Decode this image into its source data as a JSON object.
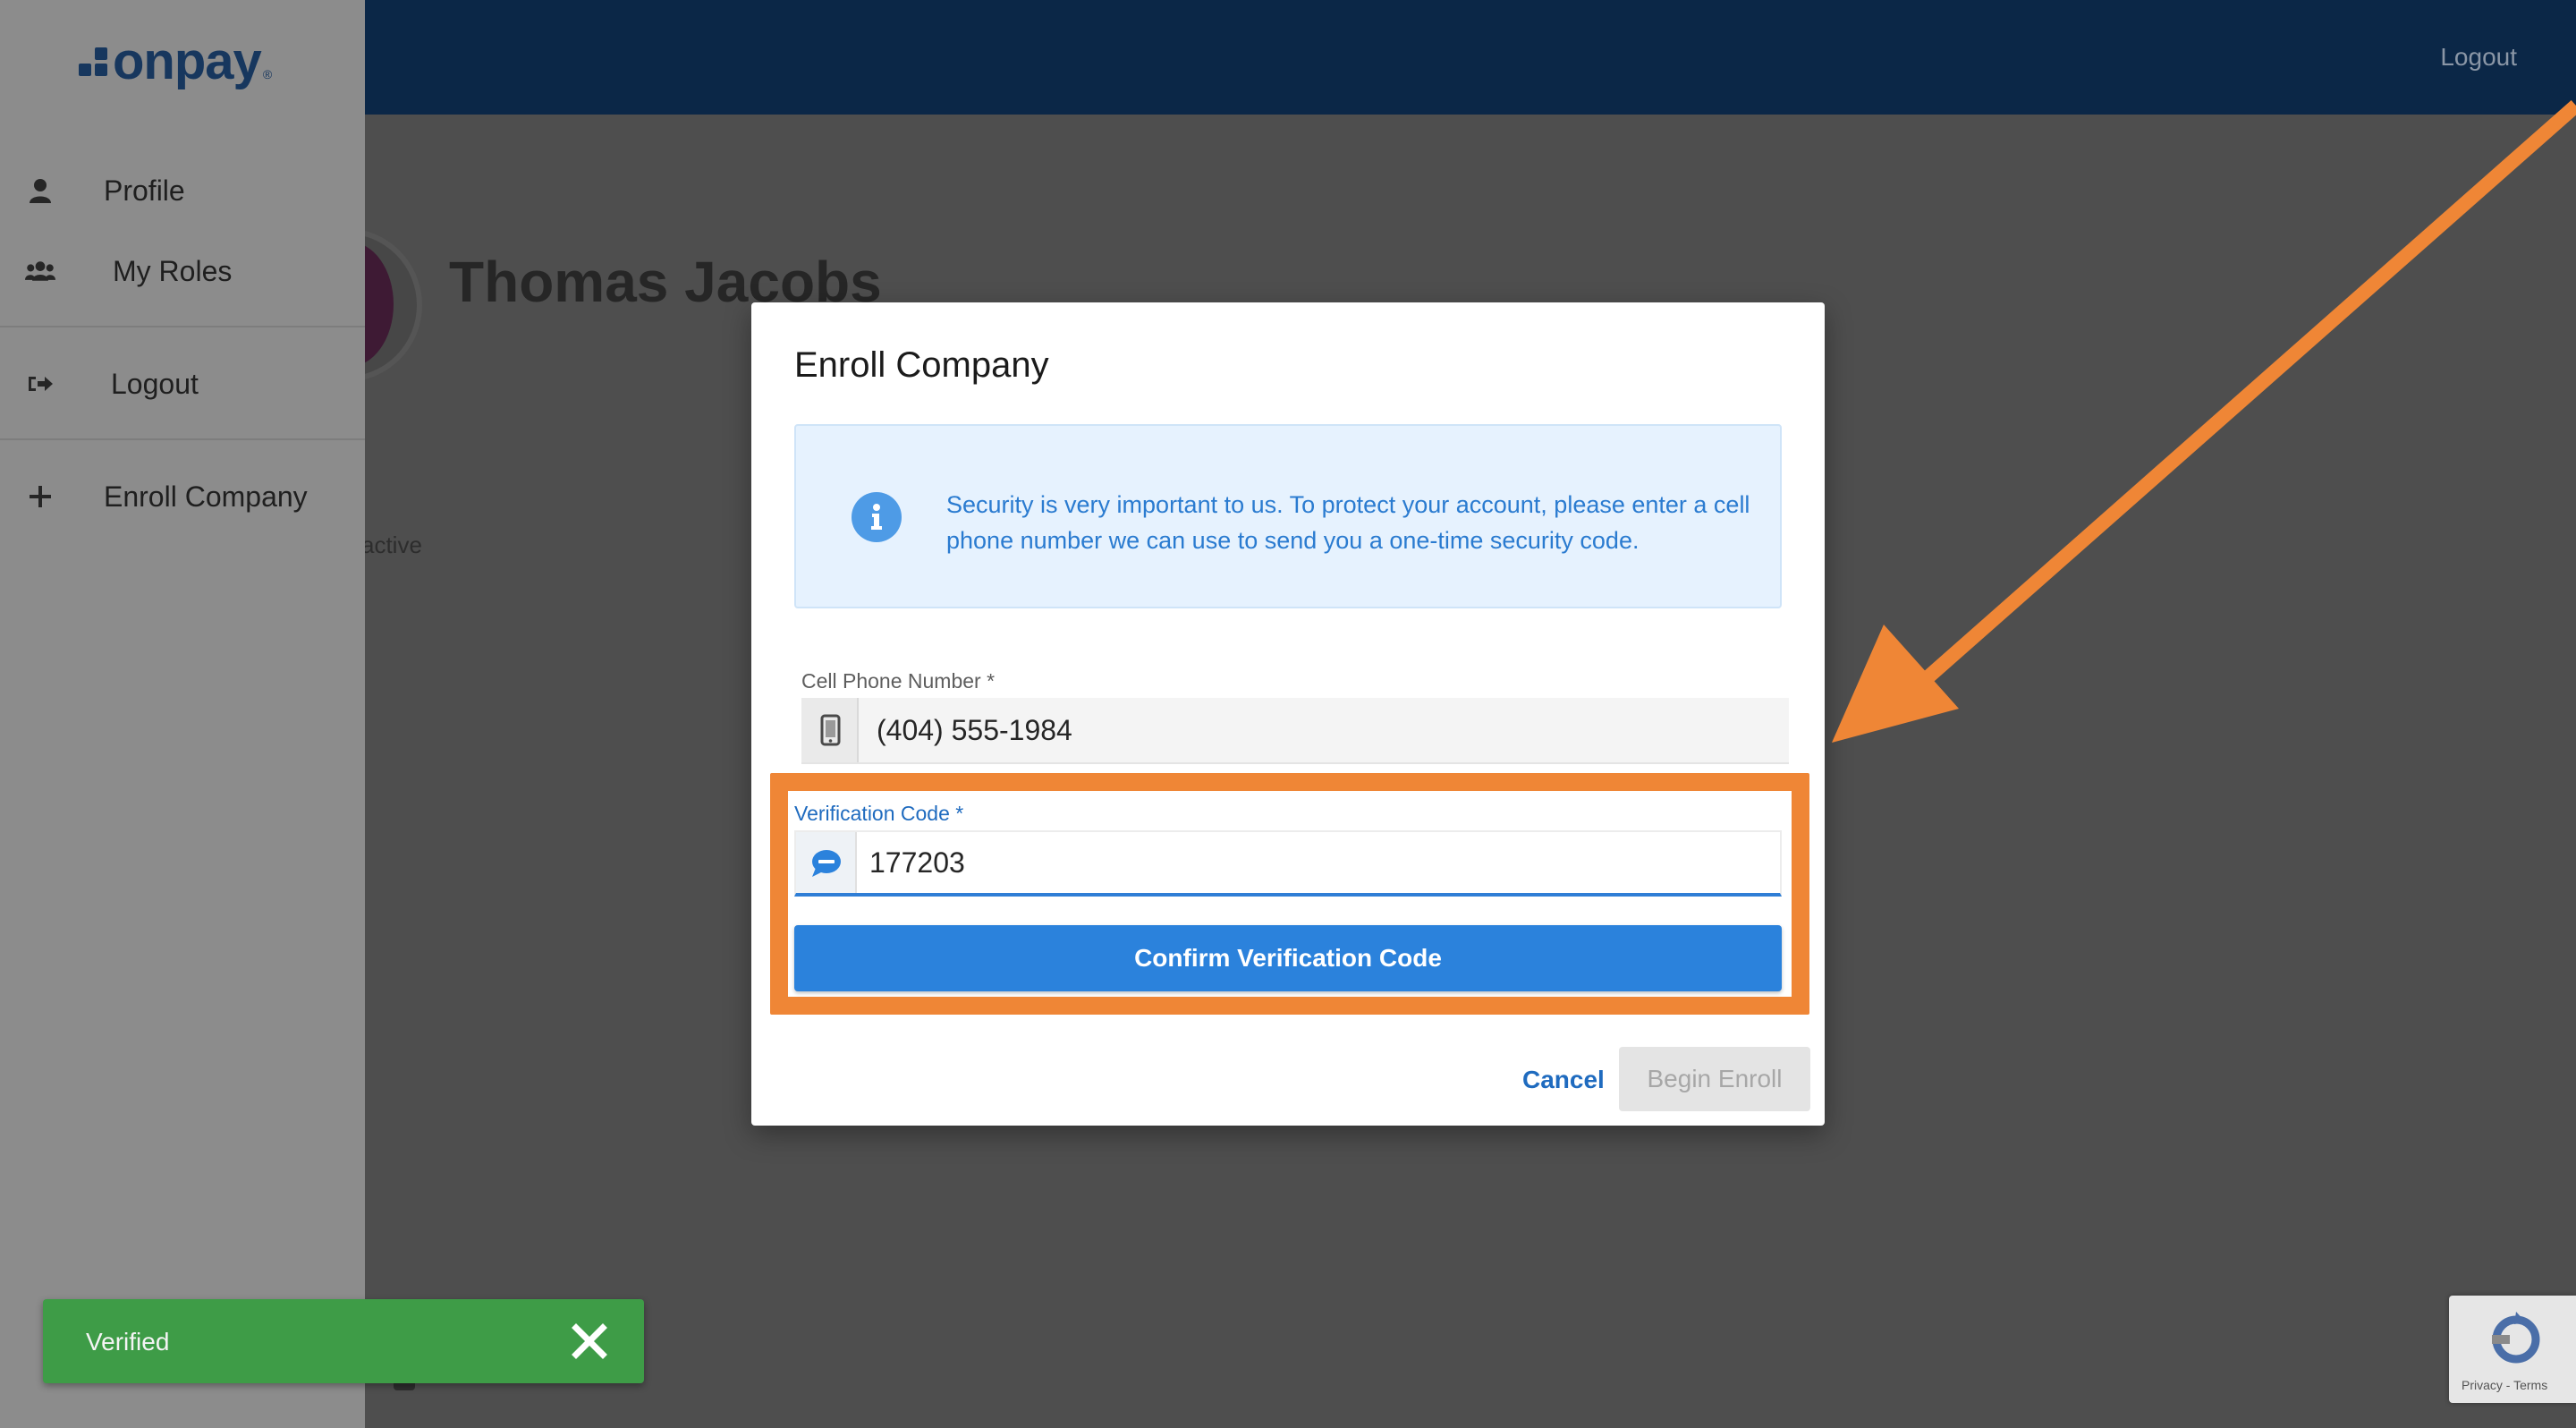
{
  "app": {
    "brand": "onpay",
    "brand_mark": "®"
  },
  "topbar": {
    "logout_label": "Logout"
  },
  "sidebar": {
    "items": [
      {
        "label": "Profile",
        "icon": "user-icon"
      },
      {
        "label": "My Roles",
        "icon": "users-icon"
      },
      {
        "label": "Logout",
        "icon": "sign-out-icon"
      },
      {
        "label": "Enroll Company",
        "icon": "plus-icon"
      }
    ]
  },
  "profile": {
    "name": "Thomas Jacobs",
    "status_fragment": "active"
  },
  "modal": {
    "title": "Enroll Company",
    "info_text": "Security is very important to us. To protect your account, please enter a cell phone number we can use to send you a one-time security code.",
    "phone": {
      "label": "Cell Phone Number *",
      "value": "(404) 555-1984",
      "icon": "mobile-phone-icon"
    },
    "code": {
      "label": "Verification Code *",
      "value": "177203",
      "icon": "sms-icon"
    },
    "confirm_label": "Confirm Verification Code",
    "cancel_label": "Cancel",
    "begin_label": "Begin Enroll"
  },
  "toast": {
    "text": "Verified",
    "close_icon": "close-icon"
  },
  "recaptcha": {
    "links": "Privacy - Terms"
  },
  "annotation": {
    "color": "#ef8636"
  },
  "colors": {
    "topbar": "#0b2747",
    "brand": "#17375e",
    "primary": "#2b82dc",
    "success": "#3e9c47",
    "info_bg": "#e6f2fe"
  }
}
